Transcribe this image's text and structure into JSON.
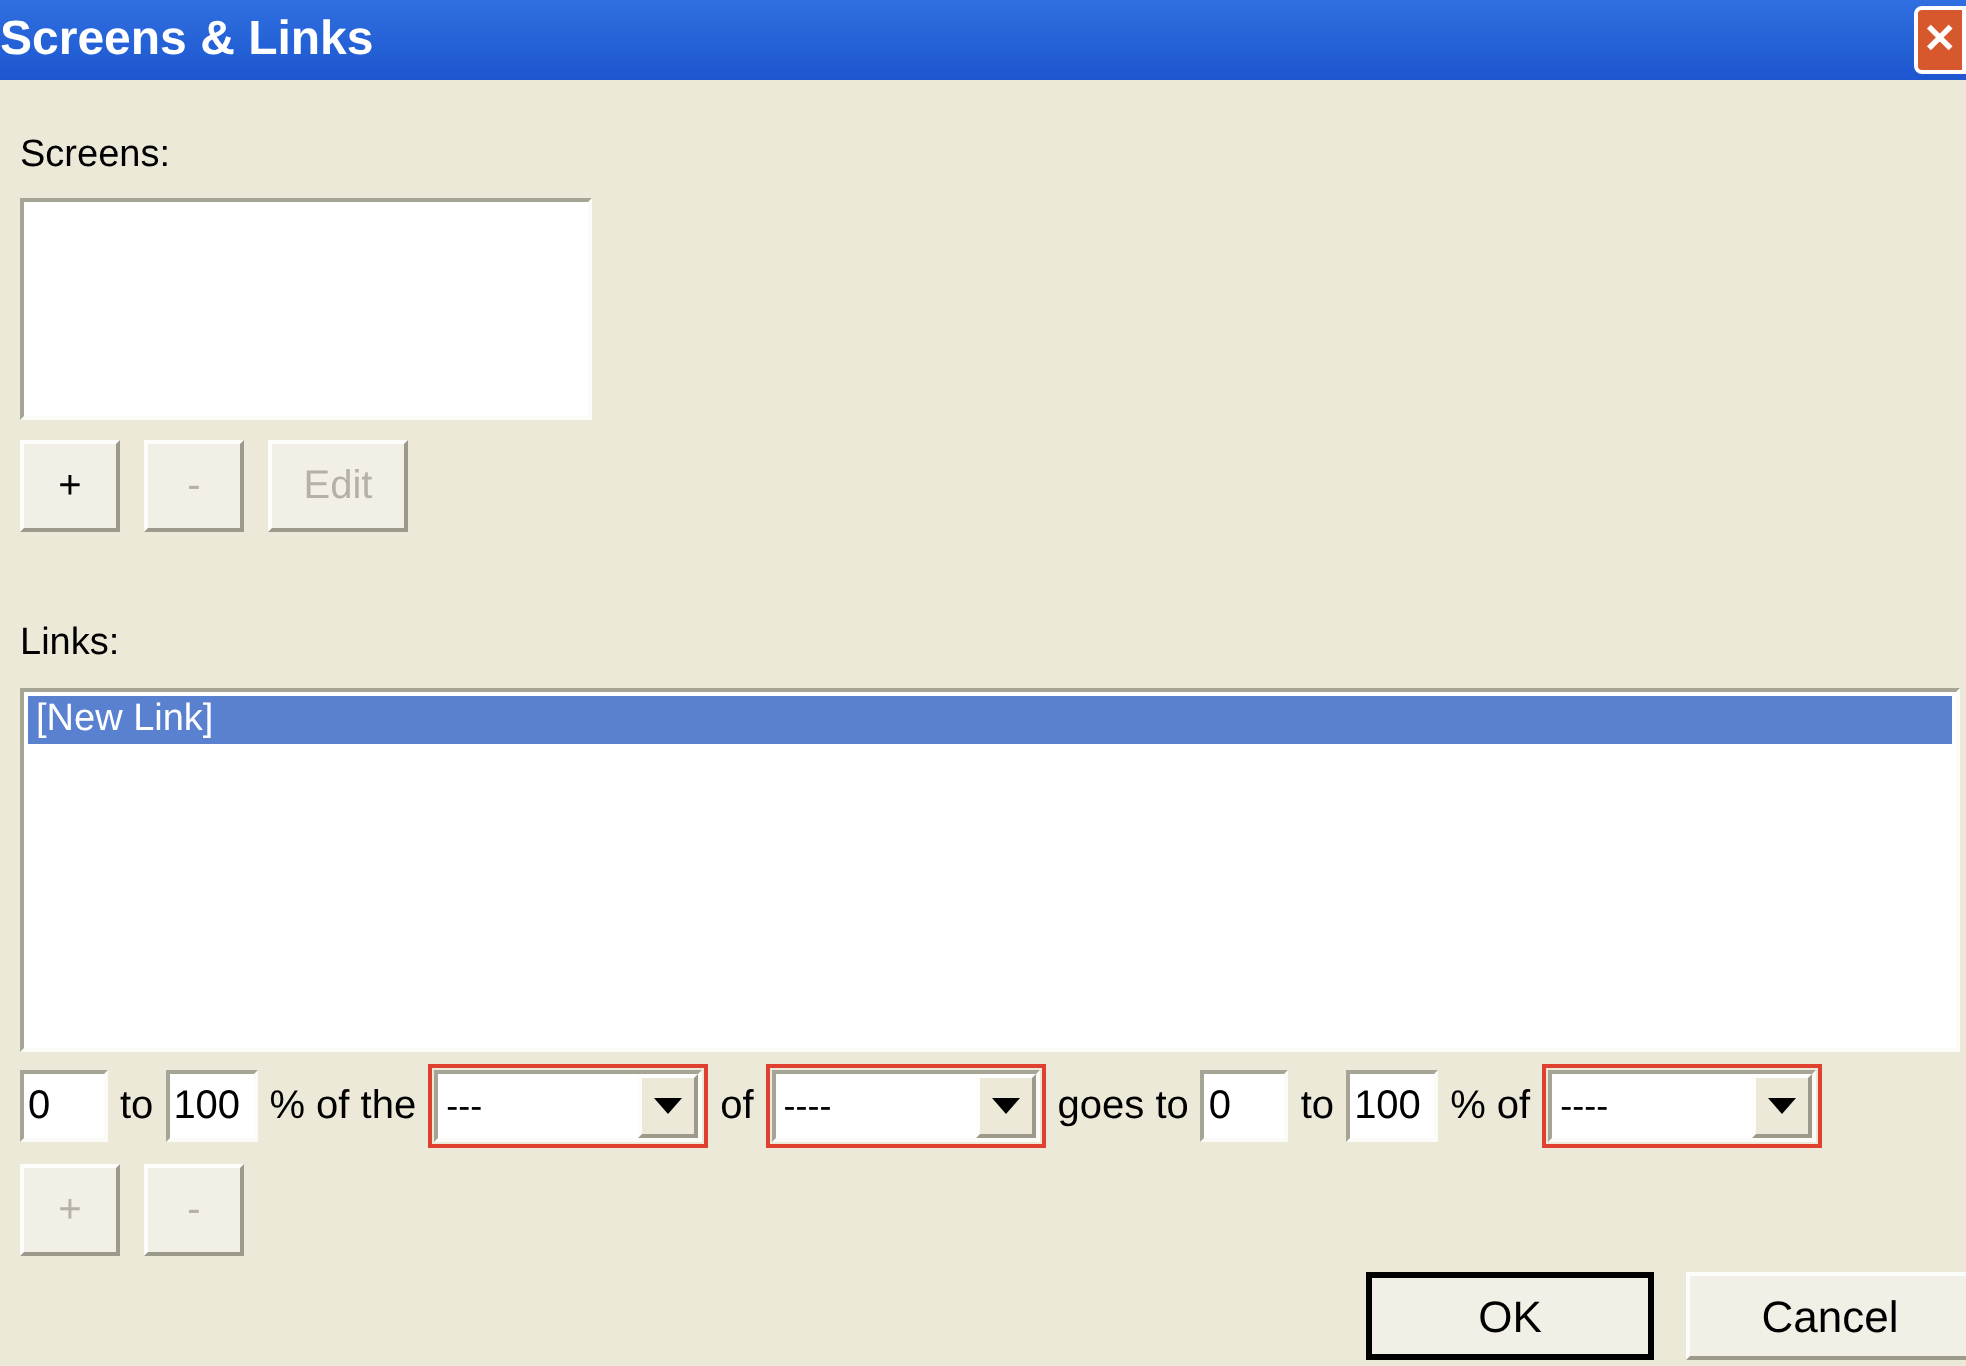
{
  "window": {
    "title": "Screens & Links",
    "close": "✕"
  },
  "screens": {
    "label": "Screens:",
    "buttons": [
      {
        "label": "+",
        "disabled": false
      },
      {
        "label": "-",
        "disabled": true
      },
      {
        "label": "Edit",
        "disabled": true
      }
    ]
  },
  "links": {
    "label": "Links:",
    "items": [
      {
        "label": "[New Link]",
        "selected": true
      }
    ],
    "rule": [
      {
        "kind": "field",
        "value": "0"
      },
      {
        "kind": "text",
        "text": "to"
      },
      {
        "kind": "field",
        "value": "100"
      },
      {
        "kind": "text",
        "text": "% of the"
      },
      {
        "kind": "dropdown",
        "value": "---",
        "invalid": true
      },
      {
        "kind": "text",
        "text": "of"
      },
      {
        "kind": "dropdown",
        "value": "----",
        "invalid": true
      },
      {
        "kind": "text",
        "text": "goes to"
      },
      {
        "kind": "field",
        "value": "0"
      },
      {
        "kind": "text",
        "text": "to"
      },
      {
        "kind": "field",
        "value": "100"
      },
      {
        "kind": "text",
        "text": "% of"
      },
      {
        "kind": "dropdown",
        "value": "----",
        "invalid": true
      }
    ],
    "buttons": [
      {
        "label": "+",
        "disabled": true
      },
      {
        "label": "-",
        "disabled": true
      }
    ]
  },
  "footer": [
    {
      "label": "OK",
      "default": true
    },
    {
      "label": "Cancel",
      "default": false
    }
  ]
}
